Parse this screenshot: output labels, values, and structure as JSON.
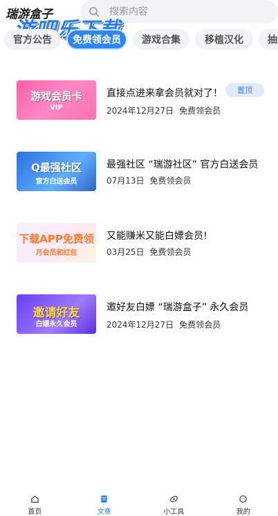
{
  "header": {
    "app_name": "瑞游盒子",
    "watermark": "游吧乐下载",
    "search_placeholder": "搜索内容"
  },
  "tabs": [
    {
      "label": "官方公告",
      "active": false
    },
    {
      "label": "免费领会员",
      "active": true
    },
    {
      "label": "游戏合集",
      "active": false
    },
    {
      "label": "移植汉化",
      "active": false
    },
    {
      "label": "抽",
      "active": false
    }
  ],
  "articles": [
    {
      "thumb_text": "游戏会员卡",
      "thumb_sub": "VIP",
      "title": "直接点进来拿会员就对了！",
      "date": "2024年12月27日",
      "category": "免费领会员",
      "badge": "置顶"
    },
    {
      "thumb_text": "Q最强社区",
      "thumb_sub": "官方白送会员",
      "title": "最强社区 “瑞游社区” 官方白送会员",
      "date": "07月13日",
      "category": "免费领会员",
      "badge": ""
    },
    {
      "thumb_text": "下载APP免费领",
      "thumb_sub": "月会员和红包",
      "title": "又能赚米又能白嫖会员!",
      "date": "03月25日",
      "category": "免费领会员",
      "badge": ""
    },
    {
      "thumb_text": "邀请好友",
      "thumb_sub": "白嫖永久会员",
      "title": "邀好友白嫖 “瑞游盒子” 永久会员",
      "date": "2024年12月27日",
      "category": "免费领会员",
      "badge": ""
    }
  ],
  "bottom_nav": [
    {
      "label": "首页",
      "icon": "home-icon",
      "active": false
    },
    {
      "label": "文章",
      "icon": "article-icon",
      "active": true
    },
    {
      "label": "小工具",
      "icon": "tools-icon",
      "active": false
    },
    {
      "label": "我的",
      "icon": "profile-icon",
      "active": false
    }
  ],
  "colors": {
    "accent": "#2f86f6",
    "tab_bg": "#f2f3f5",
    "badge_bg": "#dfeafe"
  }
}
